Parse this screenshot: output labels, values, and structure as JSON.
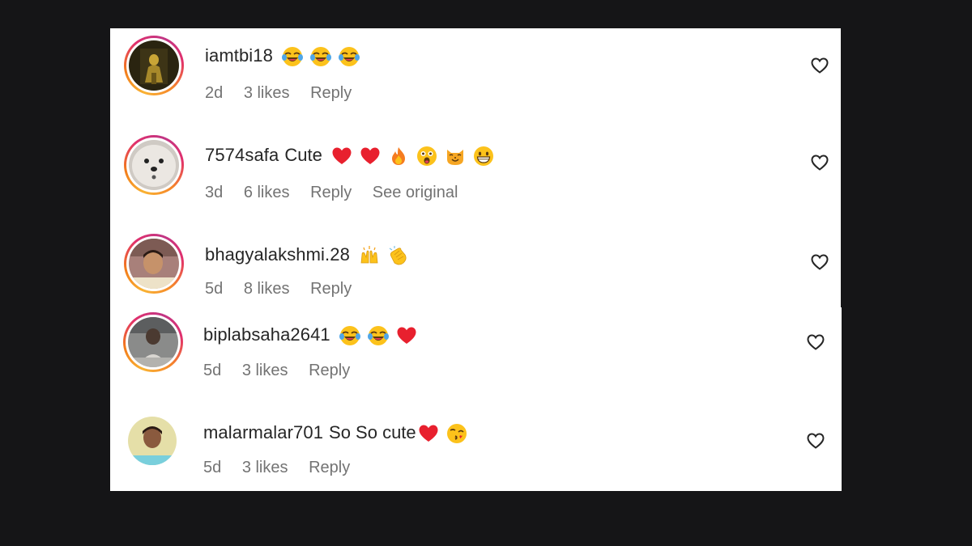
{
  "comments": [
    {
      "username": "iamtbi18",
      "text": "",
      "emojis": [
        "laugh-cry-emoji",
        "laugh-cry-emoji",
        "laugh-cry-emoji"
      ],
      "time": "2d",
      "likes": "3 likes",
      "reply": "Reply",
      "extra": "",
      "ring": true
    },
    {
      "username": "7574safa",
      "text": "Cute",
      "emojis": [
        "red-heart-emoji",
        "red-heart-emoji",
        "fire-emoji",
        "astonished-face-emoji",
        "cat-face-emoji",
        "grinning-face-emoji"
      ],
      "time": "3d",
      "likes": "6 likes",
      "reply": "Reply",
      "extra": "See original",
      "ring": true
    },
    {
      "username": "bhagyalakshmi.28",
      "text": "",
      "emojis": [
        "raising-hands-emoji",
        "clapping-hands-emoji"
      ],
      "time": "5d",
      "likes": "8 likes",
      "reply": "Reply",
      "extra": "",
      "ring": true
    },
    {
      "username": "biplabsaha2641",
      "text": "",
      "emojis": [
        "laugh-cry-emoji",
        "laugh-cry-emoji",
        "red-heart-emoji"
      ],
      "time": "5d",
      "likes": "3 likes",
      "reply": "Reply",
      "extra": "",
      "ring": true
    },
    {
      "username": "malarmalar701",
      "text": "So So cute",
      "emojis": [
        "red-heart-emoji",
        "kissing-face-emoji"
      ],
      "time": "5d",
      "likes": "3 likes",
      "reply": "Reply",
      "extra": "",
      "ring": false
    }
  ],
  "colors": {
    "page_background": "#151517",
    "panel": "#ffffff",
    "username": "#262626",
    "meta": "#737373",
    "ring_start": "#f9b233",
    "ring_end": "#c13584"
  }
}
